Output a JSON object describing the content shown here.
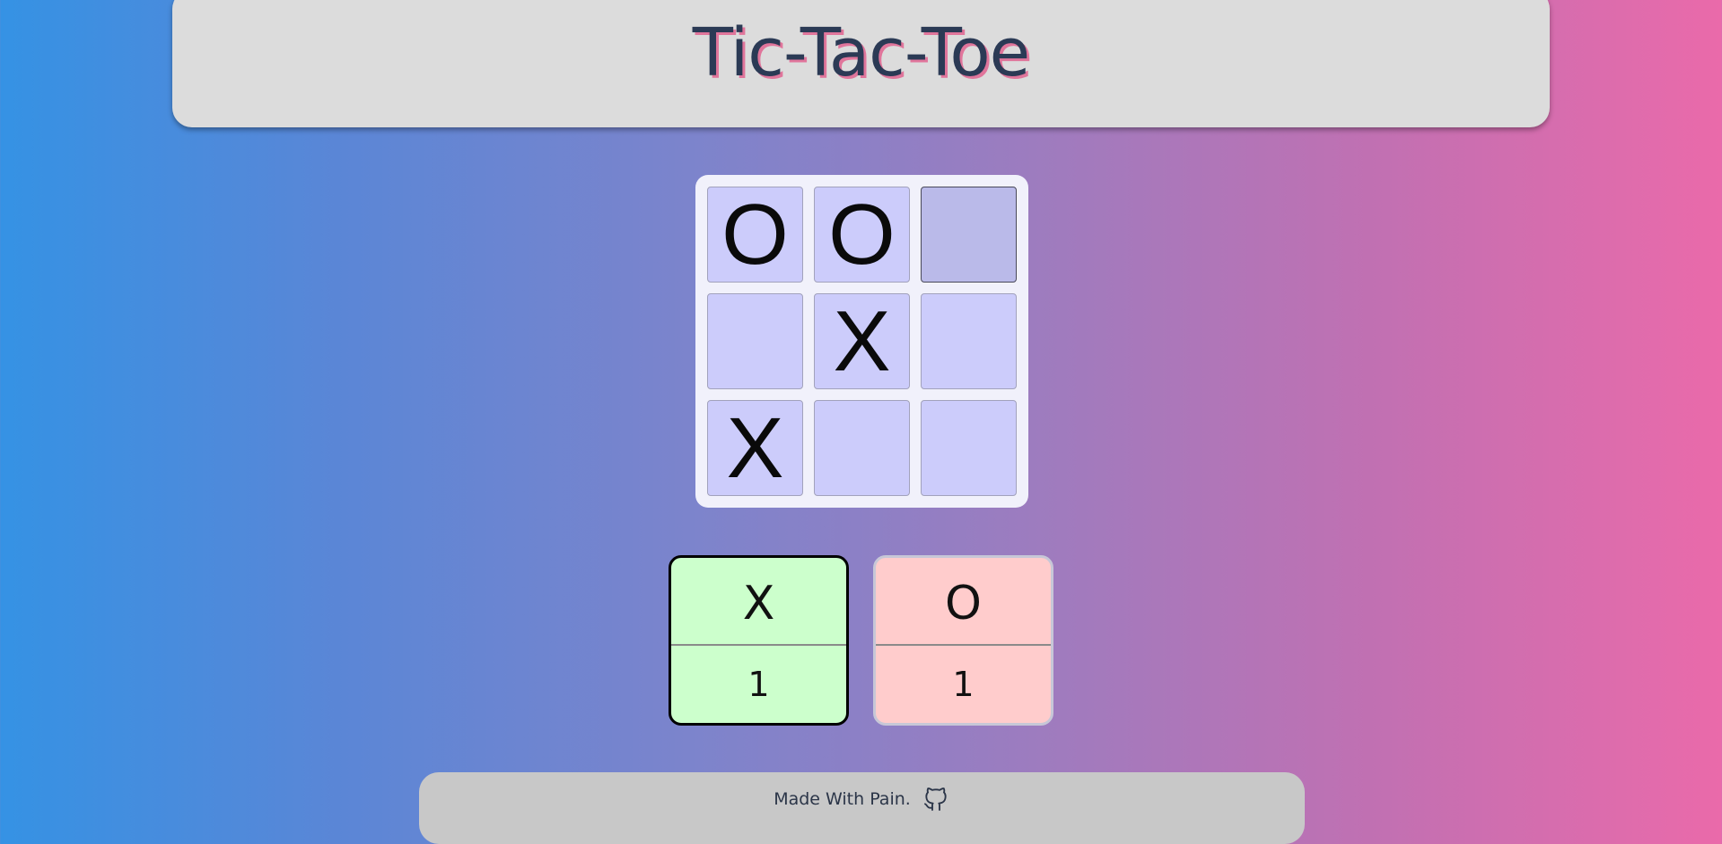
{
  "header": {
    "title": "Tic-Tac-Toe"
  },
  "board": {
    "cells": [
      "O",
      "O",
      "",
      "",
      "X",
      "",
      "X",
      "",
      ""
    ],
    "hovered_cell": 2
  },
  "scores": {
    "x": {
      "player": "X",
      "value": "1",
      "active": true
    },
    "o": {
      "player": "O",
      "value": "1",
      "active": false
    }
  },
  "footer": {
    "text": "Made With Pain.",
    "icon": "github-icon"
  },
  "colors": {
    "background_gradient_start": "#3592e4",
    "background_gradient_end": "#ea6aaa",
    "title_text": "#2b3a55",
    "title_shadow": "#e0759b",
    "cell": "#ccccfb",
    "cell_hover": "#babae9",
    "score_x": "#ccffcc",
    "score_o": "#ffcccc"
  }
}
